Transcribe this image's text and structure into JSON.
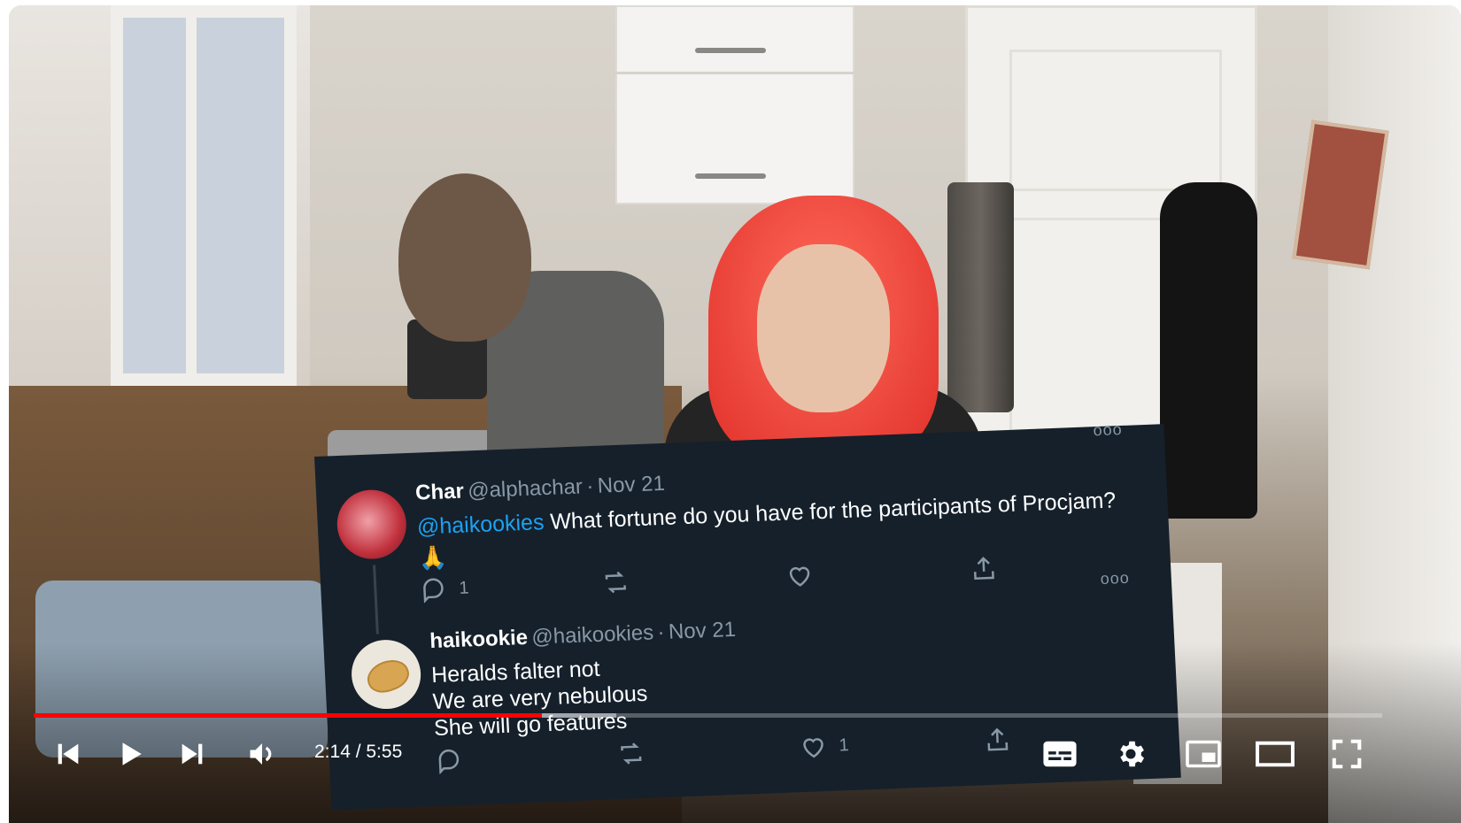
{
  "tweet": {
    "more_icon": "ooo",
    "first": {
      "name": "Char",
      "handle": "@alphachar",
      "separator": "·",
      "date": "Nov 21",
      "mention": "@haikookies",
      "text": "What fortune do you have for the participants of Procjam?",
      "emoji": "🙏",
      "reply_count": "1"
    },
    "second": {
      "name": "haikookie",
      "handle": "@haikookies",
      "separator": "·",
      "date": "Nov 21",
      "lines": [
        "Heralds falter not",
        "We are very nebulous",
        "She will go features"
      ],
      "like_count": "1"
    }
  },
  "player": {
    "time_display": "2:14 / 5:55",
    "progress": {
      "played_fraction": 0.377,
      "buffered_fraction": 0.432
    },
    "accent_color": "#ff0000",
    "icons": [
      "previous-icon",
      "play-icon",
      "next-icon",
      "volume-icon",
      "captions-icon",
      "settings-icon",
      "miniplayer-icon",
      "theater-mode-icon",
      "fullscreen-icon"
    ]
  }
}
